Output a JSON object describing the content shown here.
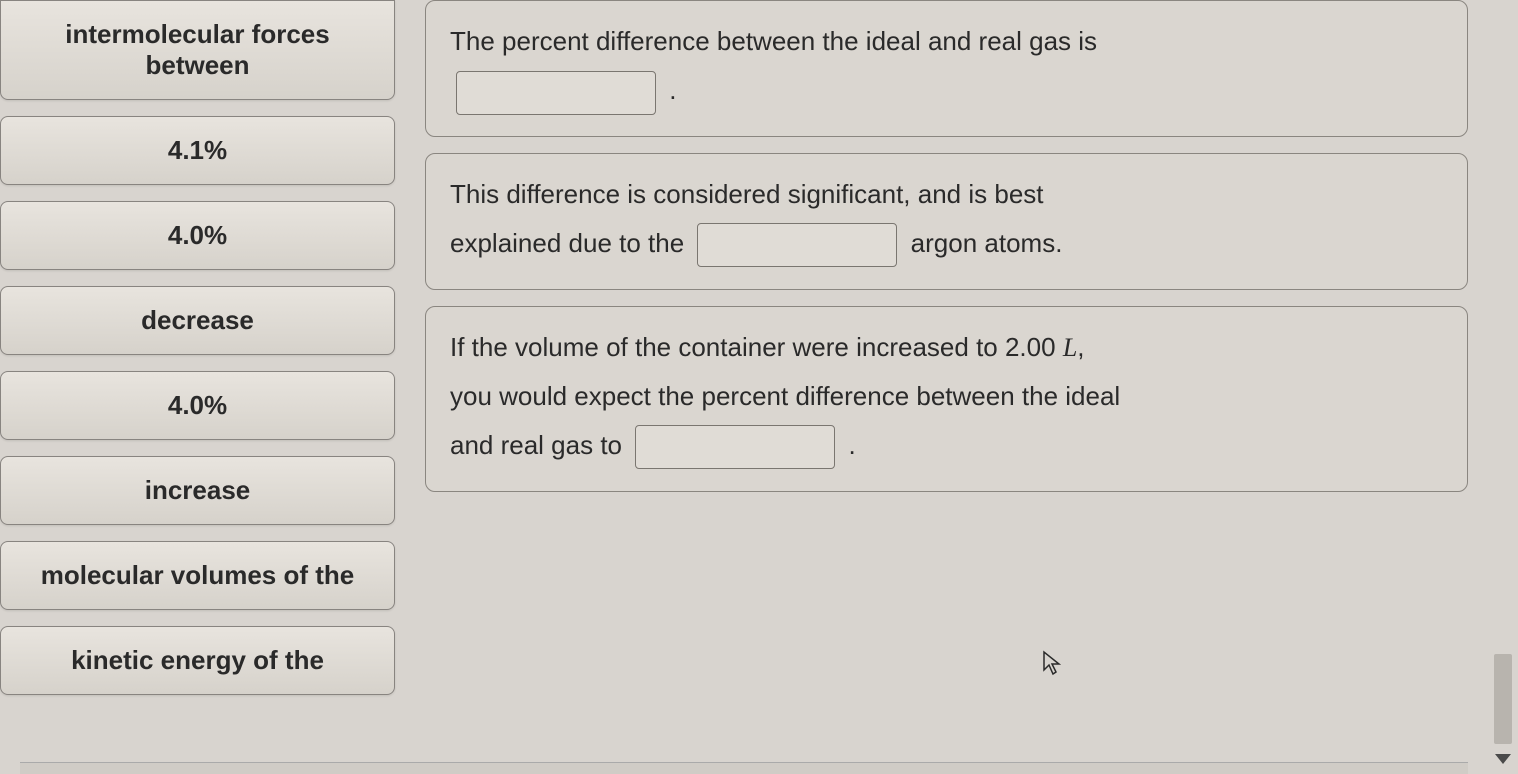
{
  "answer_bank": [
    "intermolecular forces between",
    "4.1%",
    "4.0%",
    "decrease",
    "4.0%",
    "increase",
    "molecular volumes of the",
    "kinetic energy of the"
  ],
  "targets": {
    "block1": {
      "text1": "The percent difference between the ideal and real gas is",
      "text2": "."
    },
    "block2": {
      "text1": "This difference is considered significant, and is best",
      "text2": "explained due to the",
      "text3": "argon atoms."
    },
    "block3": {
      "text1": "If the volume of the container were increased to 2.00 ",
      "volume_unit": "L",
      "text1b": ",",
      "text2": "you would expect the percent difference between the ideal",
      "text3": "and real gas to",
      "text4": "."
    }
  }
}
